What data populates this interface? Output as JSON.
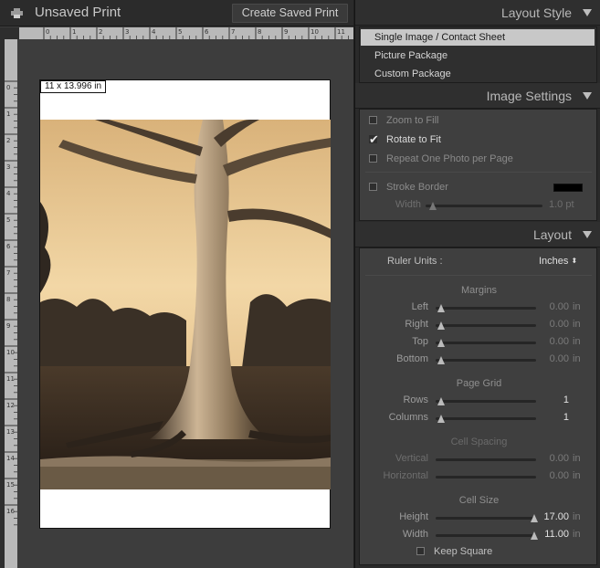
{
  "window": {
    "doc_title": "Unsaved Print",
    "create_saved_print_label": "Create Saved Print",
    "page_size_label": "11 x 13.996 in"
  },
  "rulers": {
    "horizontal_ticks": [
      "0",
      "1",
      "2",
      "3",
      "4",
      "5",
      "6",
      "7",
      "8",
      "9",
      "10",
      "11"
    ],
    "vertical_ticks": [
      "0",
      "1",
      "2",
      "3",
      "4",
      "5",
      "6",
      "7",
      "8",
      "9",
      "10",
      "11",
      "12",
      "13",
      "14",
      "15",
      "16"
    ]
  },
  "layout_style": {
    "title": "Layout Style",
    "items": [
      {
        "label": "Single Image / Contact Sheet",
        "selected": true
      },
      {
        "label": "Picture Package",
        "selected": false
      },
      {
        "label": "Custom Package",
        "selected": false
      }
    ]
  },
  "image_settings": {
    "title": "Image Settings",
    "zoom_to_fill": {
      "label": "Zoom to Fill",
      "checked": false
    },
    "rotate_to_fit": {
      "label": "Rotate to Fit",
      "checked": true
    },
    "repeat_one_photo": {
      "label": "Repeat One Photo per Page",
      "checked": false
    },
    "stroke_border": {
      "label": "Stroke Border",
      "checked": false,
      "color": "#000000"
    },
    "width": {
      "label": "Width",
      "value": "1.0 pt"
    }
  },
  "layout": {
    "title": "Layout",
    "ruler_units_label": "Ruler Units :",
    "ruler_units_value": "Inches",
    "margins": {
      "title": "Margins",
      "unit": "in",
      "rows": [
        {
          "label": "Left",
          "value": "0.00"
        },
        {
          "label": "Right",
          "value": "0.00"
        },
        {
          "label": "Top",
          "value": "0.00"
        },
        {
          "label": "Bottom",
          "value": "0.00"
        }
      ]
    },
    "page_grid": {
      "title": "Page Grid",
      "rows": [
        {
          "label": "Rows",
          "value": "1"
        },
        {
          "label": "Columns",
          "value": "1"
        }
      ]
    },
    "cell_spacing": {
      "title": "Cell Spacing",
      "unit": "in",
      "rows": [
        {
          "label": "Vertical",
          "value": "0.00"
        },
        {
          "label": "Horizontal",
          "value": "0.00"
        }
      ]
    },
    "cell_size": {
      "title": "Cell Size",
      "unit": "in",
      "rows": [
        {
          "label": "Height",
          "value": "17.00"
        },
        {
          "label": "Width",
          "value": "11.00"
        }
      ]
    },
    "keep_square": {
      "label": "Keep Square",
      "checked": false
    }
  },
  "colors": {
    "selected_item_bg": "#c8c8c8",
    "photo_sky": "#e9c896",
    "photo_dark": "#3a2e22"
  },
  "icons": {
    "printer": "printer-icon",
    "collapse": "triangle-down-icon",
    "check": "checkmark-icon",
    "stepper": "up-down-arrows-icon"
  }
}
